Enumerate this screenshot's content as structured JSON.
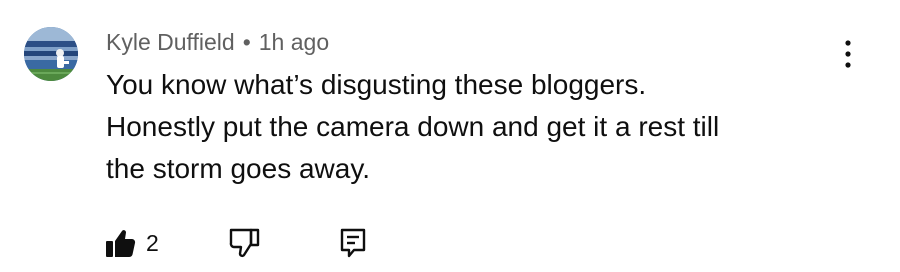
{
  "comment": {
    "author": "Kyle Duffield",
    "separator": "•",
    "time": "1h ago",
    "text": "You know what’s disgusting these bloggers.\nHonestly put the camera down and get it a rest till\nthe storm goes away.",
    "like_count": "2"
  },
  "icons": {
    "avatar": "avatar",
    "menu": "more-vert-icon",
    "like": "thumbs-up-filled-icon",
    "dislike": "thumbs-down-icon",
    "reply": "reply-icon"
  },
  "colors": {
    "meta_text": "#606060",
    "body_text": "#0f0f0f",
    "background": "#ffffff"
  }
}
